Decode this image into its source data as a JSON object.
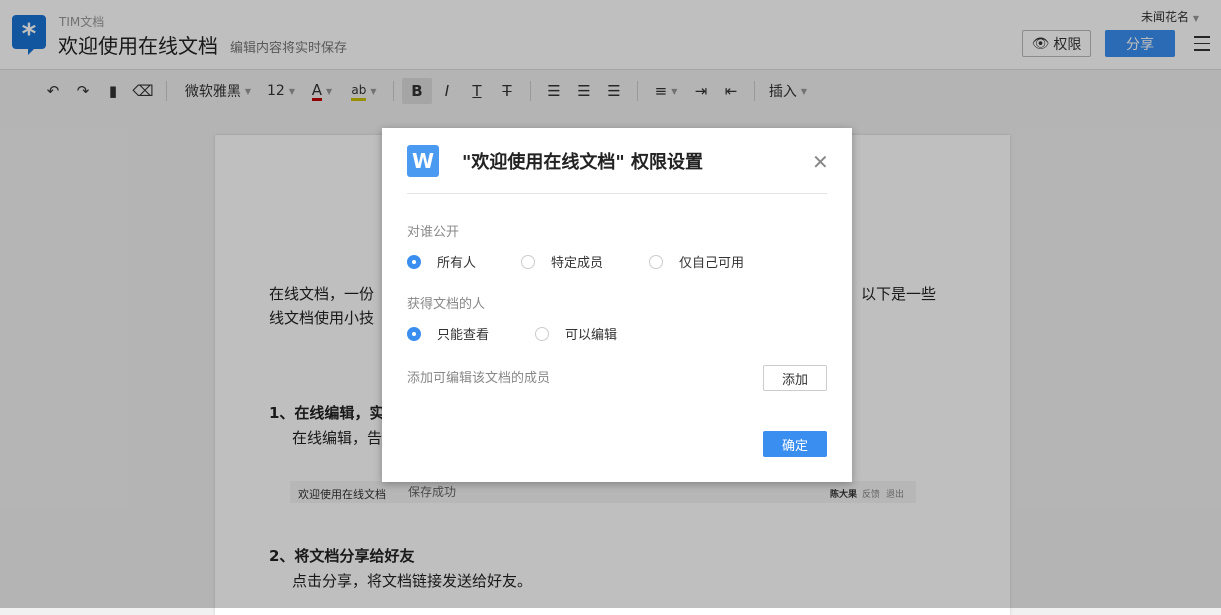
{
  "header": {
    "app_name": "TIM文档",
    "doc_title": "欢迎使用在线文档",
    "save_hint": "编辑内容将实时保存",
    "user": "未闻花名",
    "permission": "权限",
    "share": "分享"
  },
  "toolbar": {
    "font": "微软雅黑",
    "size": "12",
    "insert": "插入",
    "font_color": "#c00000",
    "highlight_color": "#c8c000"
  },
  "page": {
    "para1a": "在线文档，一份",
    "para1b": "以下是一些",
    "para2": "线文档使用小技",
    "h1": "1、在线编辑，实",
    "h1_body": "在线编辑，告",
    "strip_title": "欢迎使用在线文档",
    "strip_saved": "保存成功",
    "strip_user": "陈大果",
    "strip_feedback": "反馈",
    "strip_logout": "退出",
    "h2": "2、将文档分享给好友",
    "h2_body": "点击分享，将文档链接发送给好友。"
  },
  "dialog": {
    "logo": "W",
    "title": "\"欢迎使用在线文档\" 权限设置",
    "section1": "对谁公开",
    "visibility": [
      "所有人",
      "特定成员",
      "仅自己可用"
    ],
    "section2": "获得文档的人",
    "access": [
      "只能查看",
      "可以编辑"
    ],
    "section3": "添加可编辑该文档的成员",
    "add": "添加",
    "confirm": "确定"
  }
}
